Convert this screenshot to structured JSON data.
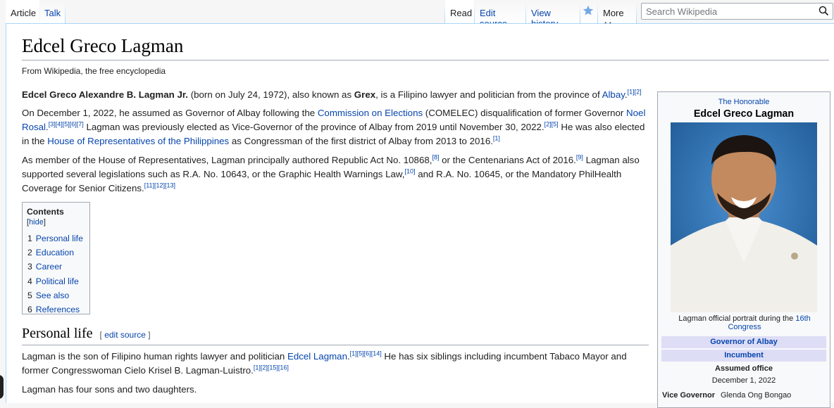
{
  "tabs": {
    "article": "Article",
    "talk": "Talk",
    "read": "Read",
    "edit_source": "Edit source",
    "view_history": "View history",
    "more": "More"
  },
  "search": {
    "placeholder": "Search Wikipedia"
  },
  "page": {
    "title": "Edcel Greco Lagman",
    "tagline": "From Wikipedia, the free encyclopedia"
  },
  "intro": {
    "p1": {
      "bold_name": "Edcel Greco Alexandre B. Lagman Jr.",
      "t1": " (born on July 24, 1972), also known as ",
      "bold_nick": "Grex",
      "t2": ", is a Filipino lawyer and politician from the province of ",
      "link_albay": "Albay",
      "t3": ".",
      "refs": "[1][2]"
    },
    "p2": {
      "t1": "On December 1, 2022, he assumed as Governor of Albay following the ",
      "link_comelec": "Commission on Elections",
      "t2": " (COMELEC) disqualification of former Governor ",
      "link_rosal": "Noel Rosal",
      "t3": ".",
      "refs1": "[3][4][5][6][7]",
      "t4": " Lagman was previously elected as Vice-Governor of the province of Albay from 2019 until November 30, 2022.",
      "refs2": "[2][5]",
      "t5": " He was also elected in the ",
      "link_house": "House of Representatives of the Philippines",
      "t6": " as Congressman of the first district of Albay from 2013 to 2016.",
      "refs3": "[1]"
    },
    "p3": {
      "t1": "As member of the House of Representatives, Lagman principally authored Republic Act No. 10868,",
      "refs1": "[8]",
      "t2": " or the Centenarians Act of 2016.",
      "refs2": "[9]",
      "t3": " Lagman also supported several legislations such as R.A. No. 10643, or the Graphic Health Warnings Law,",
      "refs3": "[10]",
      "t4": " and R.A. No. 10645, or the Mandatory PhilHealth Coverage for Senior Citizens.",
      "refs4": "[11][12][13]"
    }
  },
  "toc": {
    "title": "Contents",
    "hide": "hide",
    "items": [
      {
        "num": "1",
        "label": "Personal life"
      },
      {
        "num": "2",
        "label": "Education"
      },
      {
        "num": "3",
        "label": "Career"
      },
      {
        "num": "4",
        "label": "Political life"
      },
      {
        "num": "5",
        "label": "See also"
      },
      {
        "num": "6",
        "label": "References"
      }
    ]
  },
  "section_personal": {
    "heading": "Personal life",
    "edit": "edit source",
    "p1": {
      "t1": "Lagman is the son of Filipino human rights lawyer and politician ",
      "link_edcel": "Edcel Lagman",
      "t2": ".",
      "refs1": "[1][5][6][14]",
      "t3": " He has six siblings including incumbent Tabaco Mayor and former Congresswoman Cielo Krisel B. Lagman-Luistro.",
      "refs2": "[1][2][15][16]"
    },
    "p2": "Lagman has four sons and two daughters."
  },
  "infobox": {
    "honorific": "The Honorable",
    "name": "Edcel Greco Lagman",
    "caption_text": "Lagman official portrait during the ",
    "caption_link": "16th Congress",
    "office": "Governor of Albay",
    "status": "Incumbent",
    "assumed_label": "Assumed office",
    "assumed_date": "December 1, 2022",
    "vg_label": "Vice Governor",
    "vg_value": "Glenda Ong Bongao"
  },
  "colors": {
    "link": "#0645ad",
    "border": "#a7d7f9",
    "infobox_bar": "#ddddf6",
    "photo_bg": "#2d6ea8"
  },
  "icons": [
    "search-icon",
    "watch-star-icon",
    "chevron-down-icon"
  ]
}
